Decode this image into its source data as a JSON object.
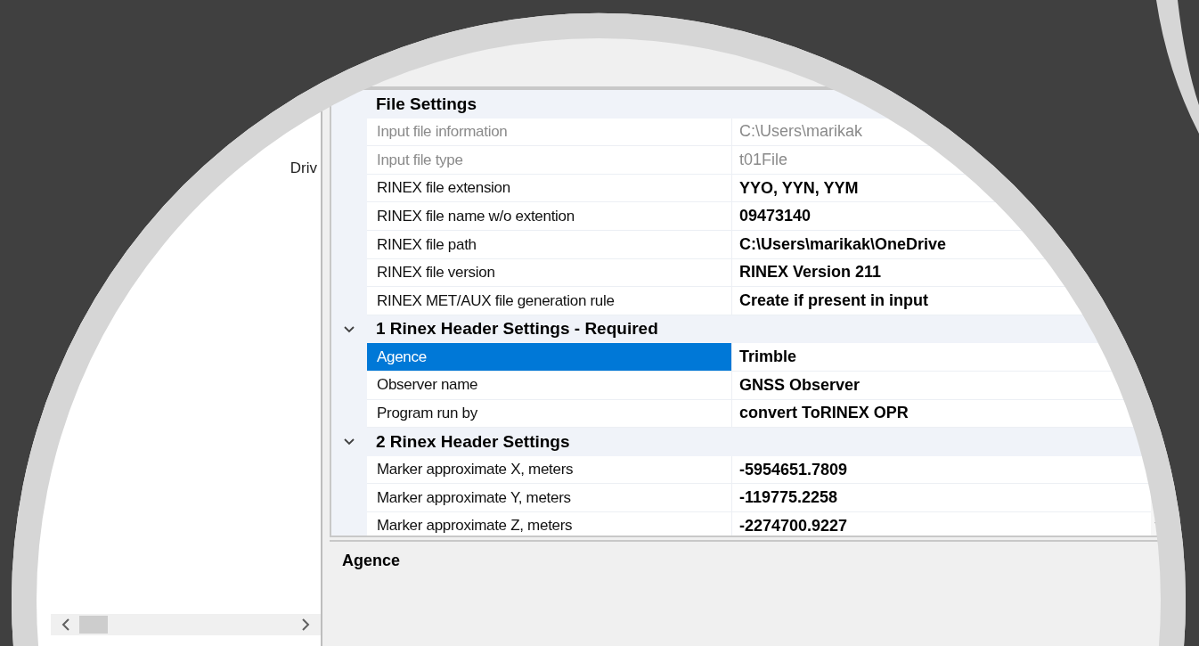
{
  "left_panel": {
    "items": [
      {
        "label": "Driv"
      }
    ]
  },
  "property_grid": {
    "groups": [
      {
        "title": "File Settings",
        "properties": [
          {
            "name": "Input file information",
            "value": "C:\\Users\\marikak",
            "disabled": true,
            "selected": false
          },
          {
            "name": "Input file type",
            "value": "t01File",
            "disabled": true,
            "selected": false
          },
          {
            "name": "RINEX file extension",
            "value": "YYO, YYN, YYM",
            "disabled": false,
            "selected": false
          },
          {
            "name": "RINEX file name w/o extention",
            "value": "09473140",
            "disabled": false,
            "selected": false
          },
          {
            "name": "RINEX file path",
            "value": "C:\\Users\\marikak\\OneDrive",
            "disabled": false,
            "selected": false
          },
          {
            "name": "RINEX file version",
            "value": "RINEX Version 211",
            "disabled": false,
            "selected": false
          },
          {
            "name": "RINEX MET/AUX file generation rule",
            "value": "Create if present in input",
            "disabled": false,
            "selected": false
          }
        ]
      },
      {
        "title": "1 Rinex Header Settings - Required",
        "expanded": true,
        "properties": [
          {
            "name": "Agence",
            "value": "Trimble",
            "disabled": false,
            "selected": true
          },
          {
            "name": "Observer name",
            "value": "GNSS Observer",
            "disabled": false,
            "selected": false
          },
          {
            "name": "Program run by",
            "value": "convert ToRINEX OPR",
            "disabled": false,
            "selected": false
          }
        ]
      },
      {
        "title": "2 Rinex Header Settings",
        "expanded": true,
        "properties": [
          {
            "name": "Marker approximate X, meters",
            "value": "-5954651.7809",
            "disabled": false,
            "selected": false
          },
          {
            "name": "Marker approximate Y, meters",
            "value": "-119775.2258",
            "disabled": false,
            "selected": false
          },
          {
            "name": "Marker approximate Z, meters",
            "value": "-2274700.9227",
            "disabled": false,
            "selected": false
          }
        ]
      }
    ]
  },
  "description": {
    "title": "Agence"
  }
}
